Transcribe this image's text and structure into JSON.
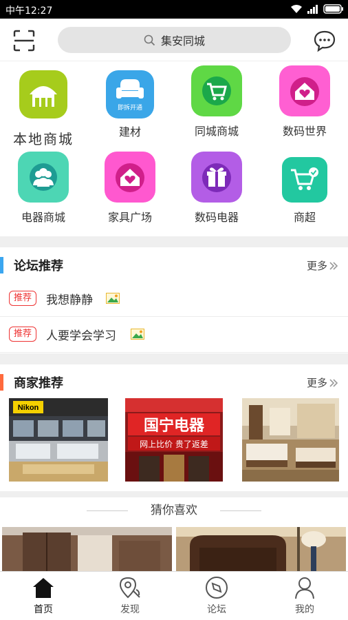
{
  "status_bar": {
    "time": "中午12:27"
  },
  "search": {
    "placeholder": "集安同城"
  },
  "categories": [
    {
      "label": "本地商城",
      "icon": "local-mall-icon",
      "color": "#a6cc1c"
    },
    {
      "label": "建材",
      "icon": "sofa-icon",
      "color": "#3aa6e8"
    },
    {
      "label": "同城商城",
      "icon": "cart-icon",
      "color": "#5fd845"
    },
    {
      "label": "数码世界",
      "icon": "house-heart-icon",
      "color": "#ff5fd2"
    },
    {
      "label": "电器商城",
      "icon": "people-icon",
      "color": "#4dd6b4"
    },
    {
      "label": "家具广场",
      "icon": "house-heart-icon",
      "color": "#ff58cf"
    },
    {
      "label": "数码电器",
      "icon": "gift-icon",
      "color": "#b35de6"
    },
    {
      "label": "商超",
      "icon": "cart-check-icon",
      "color": "#22c8a0"
    }
  ],
  "sofa_badge": "即拆开通",
  "forum": {
    "title": "论坛推荐",
    "more": "更多",
    "accent": "#3ba6f0",
    "tag": "推荐",
    "posts": [
      {
        "text": "我想静静"
      },
      {
        "text": "人要学会学习"
      }
    ]
  },
  "merchants": {
    "title": "商家推荐",
    "more": "更多",
    "accent": "#ff6a3d",
    "shop1_sign": "Nikon",
    "shop2_sign_main": "国宁电器",
    "shop2_sign_sub": "网上比价 贵了返差"
  },
  "guess": {
    "title": "猜你喜欢"
  },
  "tabs": [
    {
      "label": "首页",
      "icon": "home-icon",
      "active": true
    },
    {
      "label": "发现",
      "icon": "location-icon",
      "active": false
    },
    {
      "label": "论坛",
      "icon": "compass-icon",
      "active": false
    },
    {
      "label": "我的",
      "icon": "person-icon",
      "active": false
    }
  ]
}
